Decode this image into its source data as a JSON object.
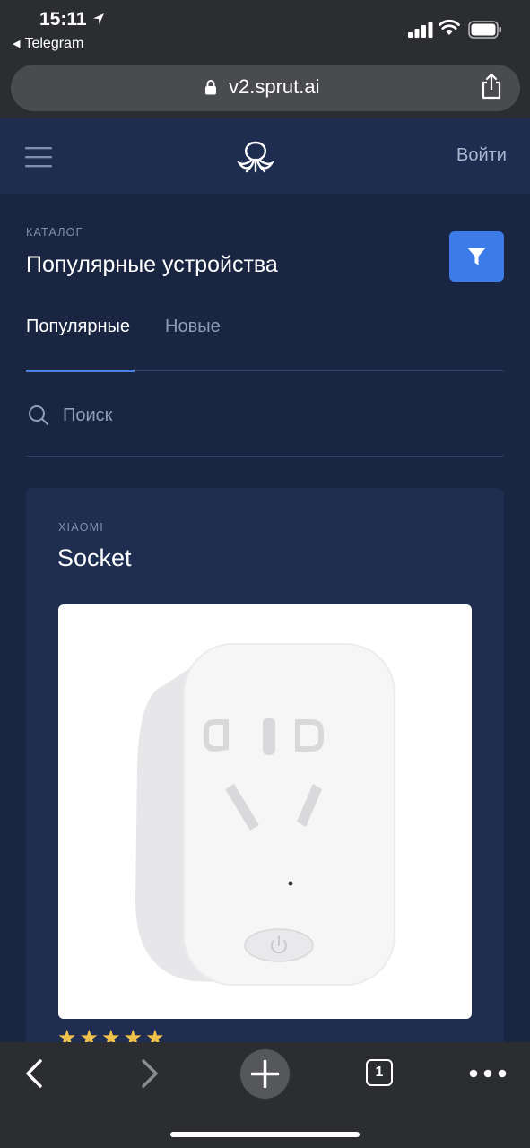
{
  "status_bar": {
    "time": "15:11",
    "back_app": "Telegram"
  },
  "browser": {
    "url": "v2.sprut.ai",
    "open_tabs": "1"
  },
  "header": {
    "login_label": "Войти"
  },
  "catalog": {
    "section_label": "КАТАЛОГ",
    "title": "Популярные устройства",
    "tabs": [
      {
        "label": "Популярные",
        "active": true
      },
      {
        "label": "Новые",
        "active": false
      }
    ],
    "search_placeholder": "Поиск"
  },
  "product": {
    "brand": "XIAOMI",
    "name": "Socket",
    "rating": 5,
    "stars": "★★★★★"
  },
  "colors": {
    "page_bg": "#1a2641",
    "header_bg": "#1e2d4f",
    "card_bg": "#1e2d50",
    "accent": "#3d7ce8",
    "star": "#f0c14b"
  }
}
